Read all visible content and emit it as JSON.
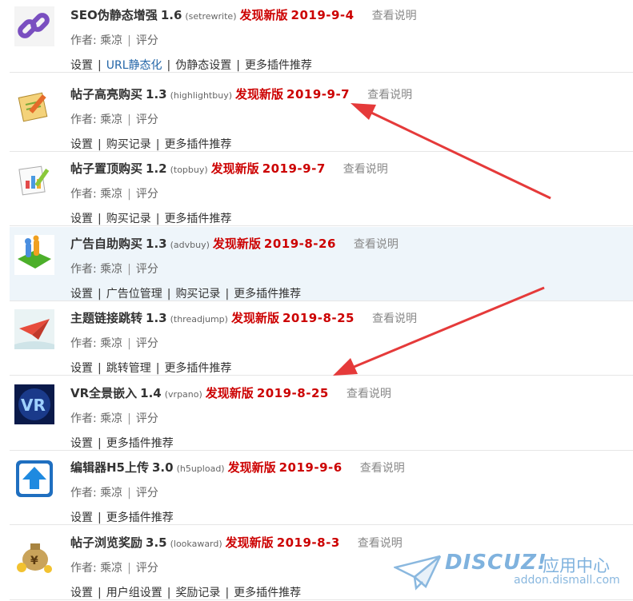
{
  "colors": {
    "new_version": "#cc0000",
    "link": "#2366a8",
    "row_highlight": "#eef5fa",
    "arrow": "#e53a3a"
  },
  "labels": {
    "new_version": "发现新版",
    "readme": "查看说明",
    "author_prefix": "作者:",
    "rate": "评分",
    "sep": "|"
  },
  "plugins": [
    {
      "name": "SEO伪静态增强",
      "version": "1.6",
      "ident": "(setrewrite)",
      "new_date": "2019-9-4",
      "author": "乘凉",
      "icon": "chain-link-icon",
      "links": [
        "设置",
        "URL静态化",
        "伪静态设置",
        "更多插件推荐"
      ],
      "highlighted": false
    },
    {
      "name": "帖子高亮购买",
      "version": "1.3",
      "ident": "(highlightbuy)",
      "new_date": "2019-9-7",
      "author": "乘凉",
      "icon": "notepad-pencil-icon",
      "links": [
        "设置",
        "购买记录",
        "更多插件推荐"
      ],
      "highlighted": false
    },
    {
      "name": "帖子置顶购买",
      "version": "1.2",
      "ident": "(topbuy)",
      "new_date": "2019-9-7",
      "author": "乘凉",
      "icon": "chart-pencil-icon",
      "links": [
        "设置",
        "购买记录",
        "更多插件推荐"
      ],
      "highlighted": false
    },
    {
      "name": "广告自助购买",
      "version": "1.3",
      "ident": "(advbuy)",
      "new_date": "2019-8-26",
      "author": "乘凉",
      "icon": "people-board-icon",
      "links": [
        "设置",
        "广告位管理",
        "购买记录",
        "更多插件推荐"
      ],
      "highlighted": true
    },
    {
      "name": "主题链接跳转",
      "version": "1.3",
      "ident": "(threadjump)",
      "new_date": "2019-8-25",
      "author": "乘凉",
      "icon": "paper-plane-icon",
      "links": [
        "设置",
        "跳转管理",
        "更多插件推荐"
      ],
      "highlighted": false
    },
    {
      "name": "VR全景嵌入",
      "version": "1.4",
      "ident": "(vrpano)",
      "new_date": "2019-8-25",
      "author": "乘凉",
      "icon": "vr-logo-icon",
      "links": [
        "设置",
        "更多插件推荐"
      ],
      "highlighted": false
    },
    {
      "name": "编辑器H5上传",
      "version": "3.0",
      "ident": "(h5upload)",
      "new_date": "2019-9-6",
      "author": "乘凉",
      "icon": "upload-arrow-icon",
      "links": [
        "设置",
        "更多插件推荐"
      ],
      "highlighted": false
    },
    {
      "name": "帖子浏览奖励",
      "version": "3.5",
      "ident": "(lookaward)",
      "new_date": "2019-8-3",
      "author": "乘凉",
      "icon": "money-bag-icon",
      "links": [
        "设置",
        "用户组设置",
        "奖励记录",
        "更多插件推荐"
      ],
      "highlighted": false
    }
  ],
  "watermark": {
    "brand": "DISCUZ!",
    "cn": "应用中心",
    "url": "addon.dismall.com",
    "icon": "paper-plane-logo-icon"
  }
}
